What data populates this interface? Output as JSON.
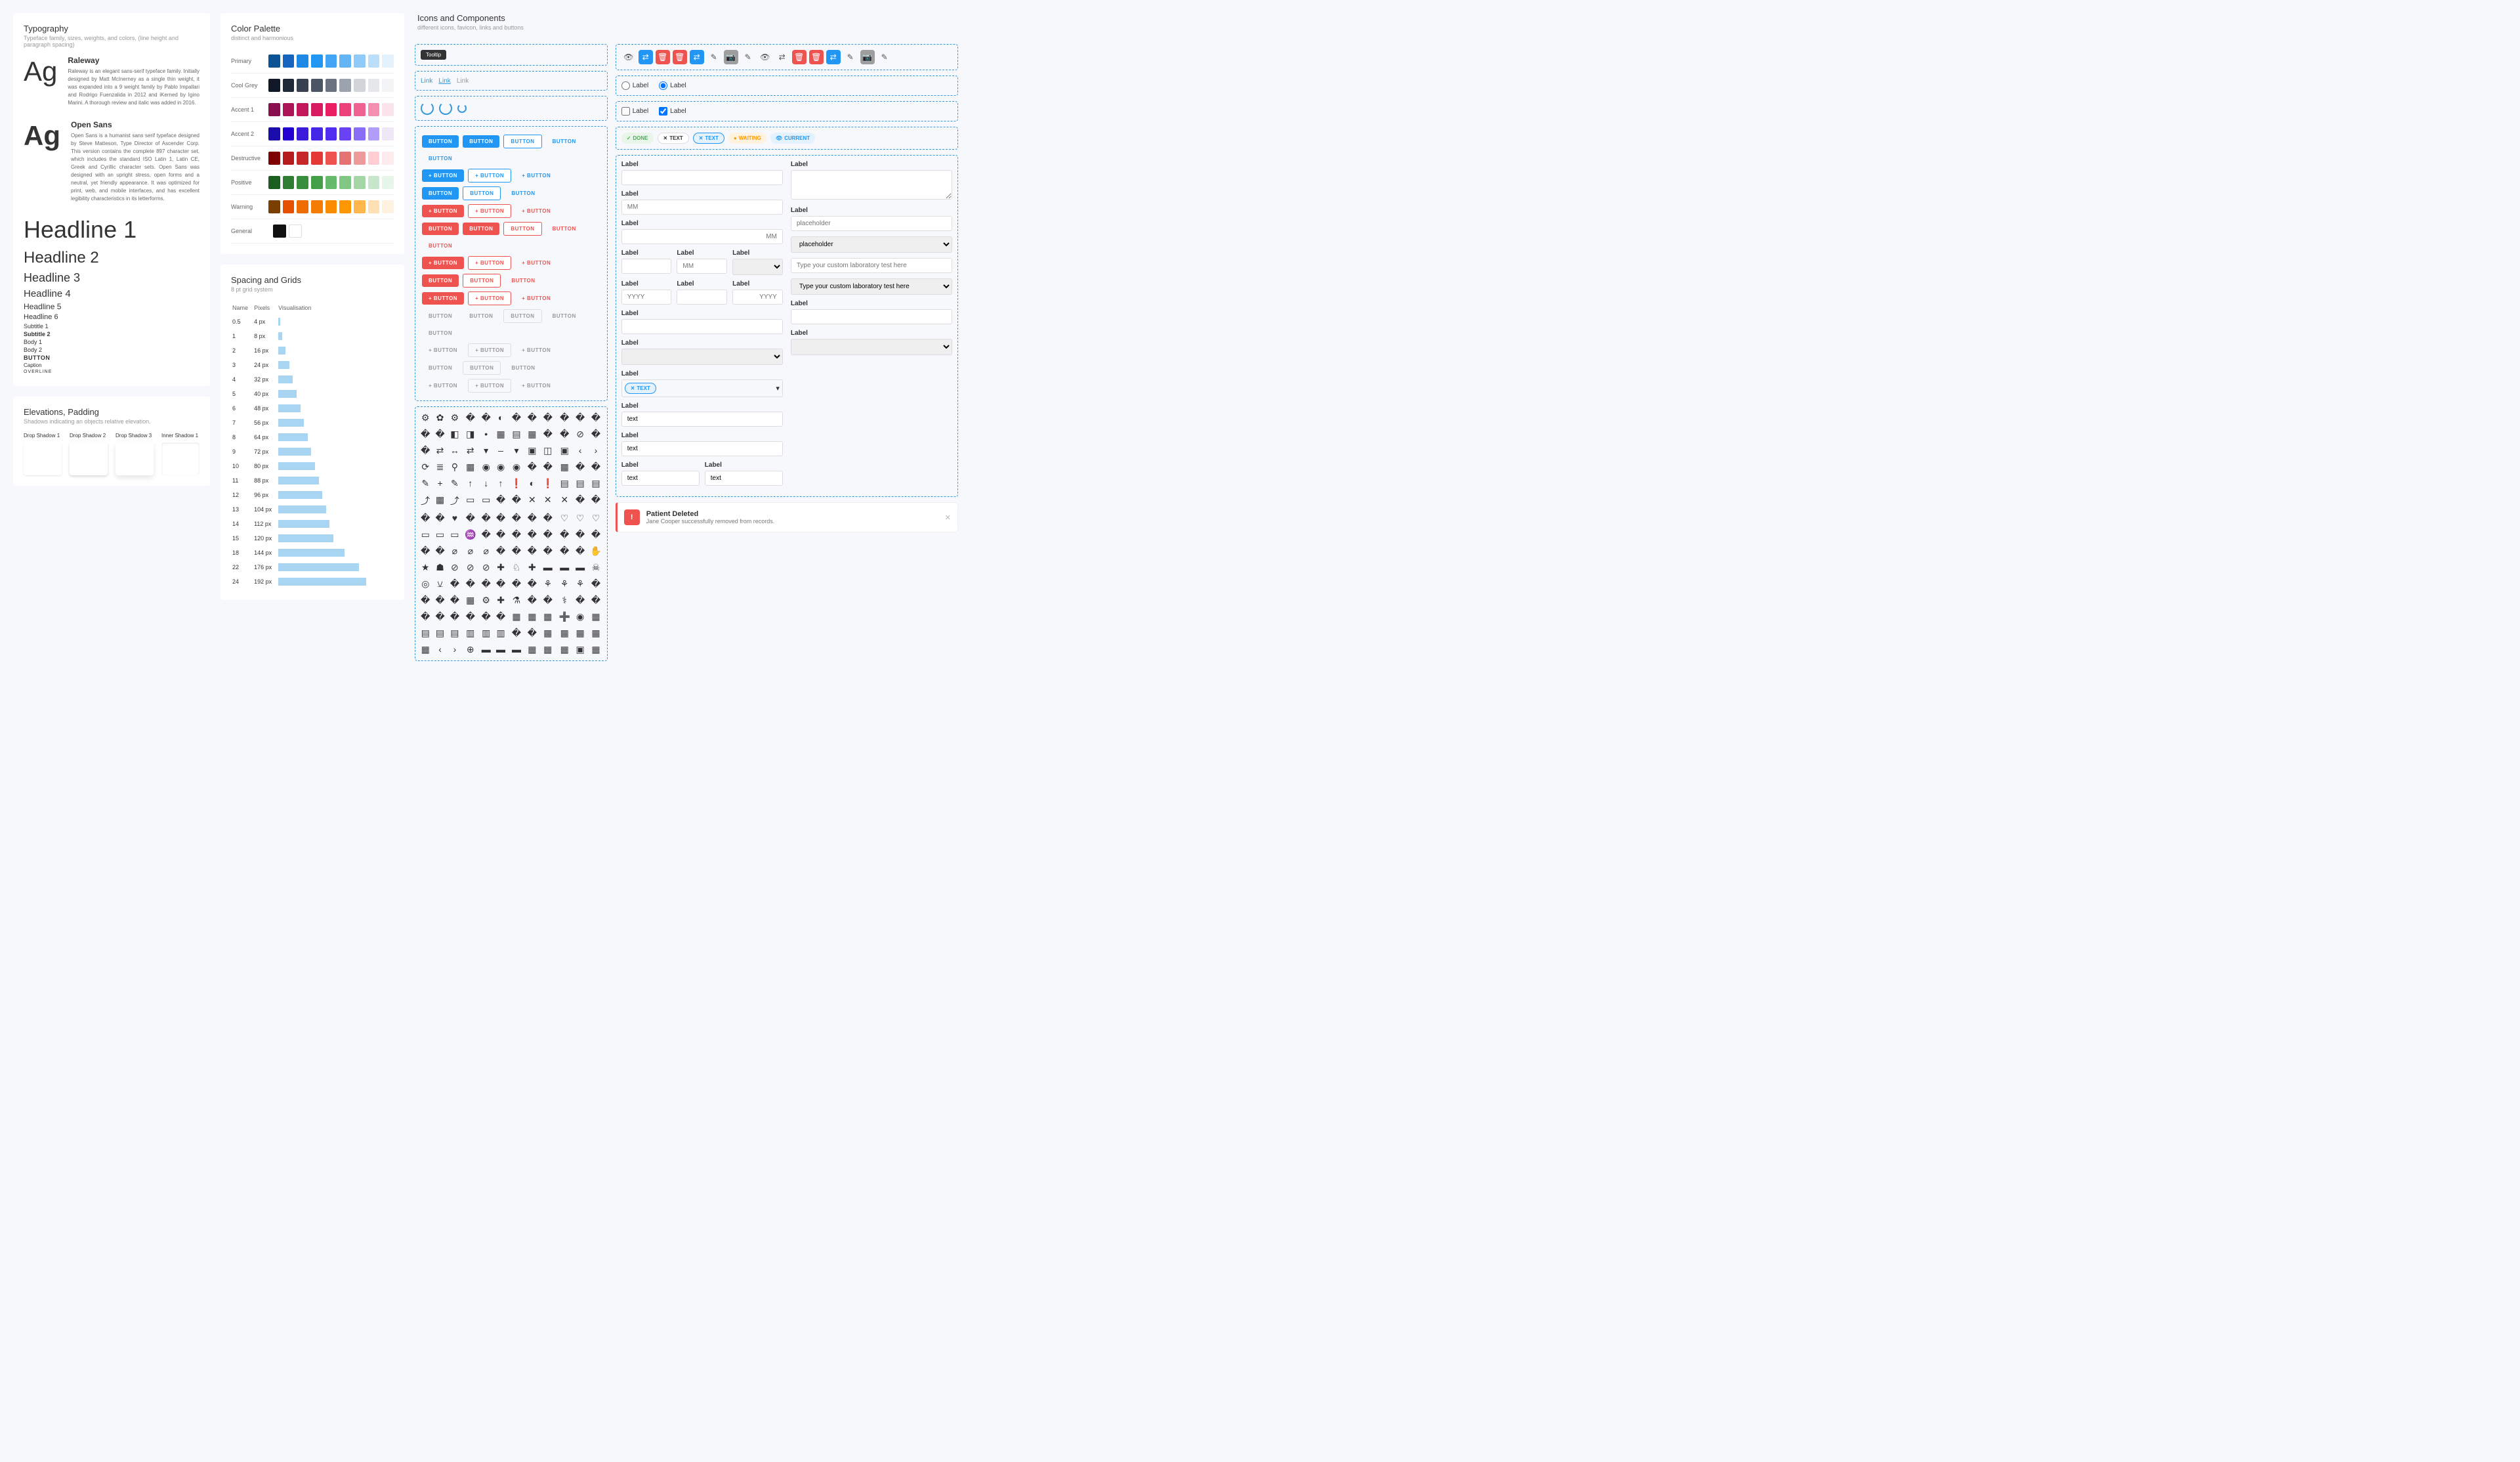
{
  "typography": {
    "title": "Typography",
    "subtitle": "Typeface family, sizes, weights, and colors, (line height and paragraph spacing)",
    "sample1": {
      "ag": "Ag",
      "name": "Raleway",
      "desc": "Raleway is an elegant sans-serif typeface family. Initially designed by Matt McInerney as a single thin weight, it was expanded into a 9 weight family by Pablo Impallari and Rodrigo Fuenzalida in 2012 and iKerned by Igino Marini. A thorough review and italic was added in 2016."
    },
    "sample2": {
      "ag": "Ag",
      "name": "Open Sans",
      "desc": "Open Sans is a humanist sans serif typeface designed by Steve Matteson, Type Director of Ascender Corp. This version contains the complete 897 character set, which includes the standard ISO Latin 1, Latin CE, Greek and Cyrillic character sets. Open Sans was designed with an upright stress, open forms and a neutral, yet friendly appearance. It was optimized for print, web, and mobile interfaces, and has excellent legibility characteristics in its letterforms."
    },
    "scale": {
      "h1": "Headline 1",
      "h2": "Headline 2",
      "h3": "Headline 3",
      "h4": "Headline 4",
      "h5": "Headline 5",
      "h6": "Headline 6",
      "s1": "Subtitle 1",
      "s2": "Subtitle 2",
      "b1": "Body  1",
      "b2": "Body  2",
      "btn": "BUTTON",
      "cap": "Caption",
      "ov": "OVERLINE"
    }
  },
  "elevations": {
    "title": "Elevations, Padding",
    "subtitle": "Shadows indicating an objects relative elevation.",
    "labels": [
      "Drop Shadow 1",
      "Drop Shadow 2",
      "Drop Shadow 3",
      "Inner Shadow 1"
    ]
  },
  "palette": {
    "title": "Color Palette",
    "subtitle": "distinct and harmonious",
    "rows": [
      {
        "name": "Primary",
        "colors": [
          "#0b5394",
          "#1565c0",
          "#1e88e5",
          "#2196f3",
          "#42a5f5",
          "#64b5f6",
          "#90caf9",
          "#bbdefb",
          "#e3f2fd"
        ]
      },
      {
        "name": "Cool Grey",
        "colors": [
          "#111827",
          "#1f2937",
          "#374151",
          "#4b5563",
          "#6b7280",
          "#9ca3af",
          "#d1d5db",
          "#e5e7eb",
          "#f3f4f6"
        ]
      },
      {
        "name": "Accent 1",
        "colors": [
          "#880e4f",
          "#ad1457",
          "#c2185b",
          "#d81b60",
          "#e91e63",
          "#ec407a",
          "#f06292",
          "#f48fb1",
          "#fce4ec"
        ]
      },
      {
        "name": "Accent 2",
        "colors": [
          "#1a0dab",
          "#2300d1",
          "#3d1bdb",
          "#4527e8",
          "#512df0",
          "#6a42f5",
          "#8a6ef7",
          "#b39dfb",
          "#ede7f6"
        ]
      },
      {
        "name": "Destructive",
        "colors": [
          "#7f0000",
          "#b71c1c",
          "#c62828",
          "#e53935",
          "#ef5350",
          "#e57373",
          "#ef9a9a",
          "#ffcdd2",
          "#ffebee"
        ]
      },
      {
        "name": "Positive",
        "colors": [
          "#1b5e20",
          "#2e7d32",
          "#388e3c",
          "#43a047",
          "#66bb6a",
          "#81c784",
          "#a5d6a7",
          "#c8e6c9",
          "#e8f5e9"
        ]
      },
      {
        "name": "Warning",
        "colors": [
          "#7a3e00",
          "#e65100",
          "#ef6c00",
          "#f57c00",
          "#fb8c00",
          "#ff9800",
          "#ffb74d",
          "#ffe0b2",
          "#fff3e0"
        ]
      },
      {
        "name": "General",
        "colors": [
          "#111",
          "#fff"
        ]
      }
    ]
  },
  "spacing": {
    "title": "Spacing and Grids",
    "subtitle": "8 pt grid system",
    "headers": [
      "Name",
      "Pixels",
      "Visualisation"
    ],
    "rows": [
      {
        "n": "0.5",
        "p": "4 px",
        "w": 4
      },
      {
        "n": "1",
        "p": "8 px",
        "w": 8
      },
      {
        "n": "2",
        "p": "16 px",
        "w": 16
      },
      {
        "n": "3",
        "p": "24 px",
        "w": 24
      },
      {
        "n": "4",
        "p": "32 px",
        "w": 32
      },
      {
        "n": "5",
        "p": "40 px",
        "w": 40
      },
      {
        "n": "6",
        "p": "48 px",
        "w": 48
      },
      {
        "n": "7",
        "p": "56 px",
        "w": 56
      },
      {
        "n": "8",
        "p": "64 px",
        "w": 64
      },
      {
        "n": "9",
        "p": "72 px",
        "w": 72
      },
      {
        "n": "10",
        "p": "80 px",
        "w": 80
      },
      {
        "n": "11",
        "p": "88 px",
        "w": 88
      },
      {
        "n": "12",
        "p": "96 px",
        "w": 96
      },
      {
        "n": "13",
        "p": "104 px",
        "w": 104
      },
      {
        "n": "14",
        "p": "112 px",
        "w": 112
      },
      {
        "n": "15",
        "p": "120 px",
        "w": 120
      },
      {
        "n": "18",
        "p": "144 px",
        "w": 144
      },
      {
        "n": "22",
        "p": "176 px",
        "w": 176
      },
      {
        "n": "24",
        "p": "192 px",
        "w": 192
      }
    ]
  },
  "components": {
    "title": "Icons and Components",
    "subtitle": "different icons, favicon, links and buttons",
    "tooltip": "Tooltip",
    "links": [
      "Link",
      "Link",
      "Link"
    ],
    "button": "BUTTON",
    "plus_button": "+ BUTTON",
    "label": "Label",
    "placeholders": {
      "mm": "MM",
      "yyyy": "YYYY",
      "ph": "placeholder",
      "lab": "Type your custom laboratory test here",
      "text": "text"
    },
    "chips": {
      "done": "DONE",
      "text": "TEXT",
      "text2": "TEXT",
      "waiting": "WAITING",
      "current": "CURRENT"
    },
    "chip_text": "TEXT",
    "alert": {
      "title": "Patient Deleted",
      "msg": "Jane Cooper successfully removed from records."
    }
  }
}
